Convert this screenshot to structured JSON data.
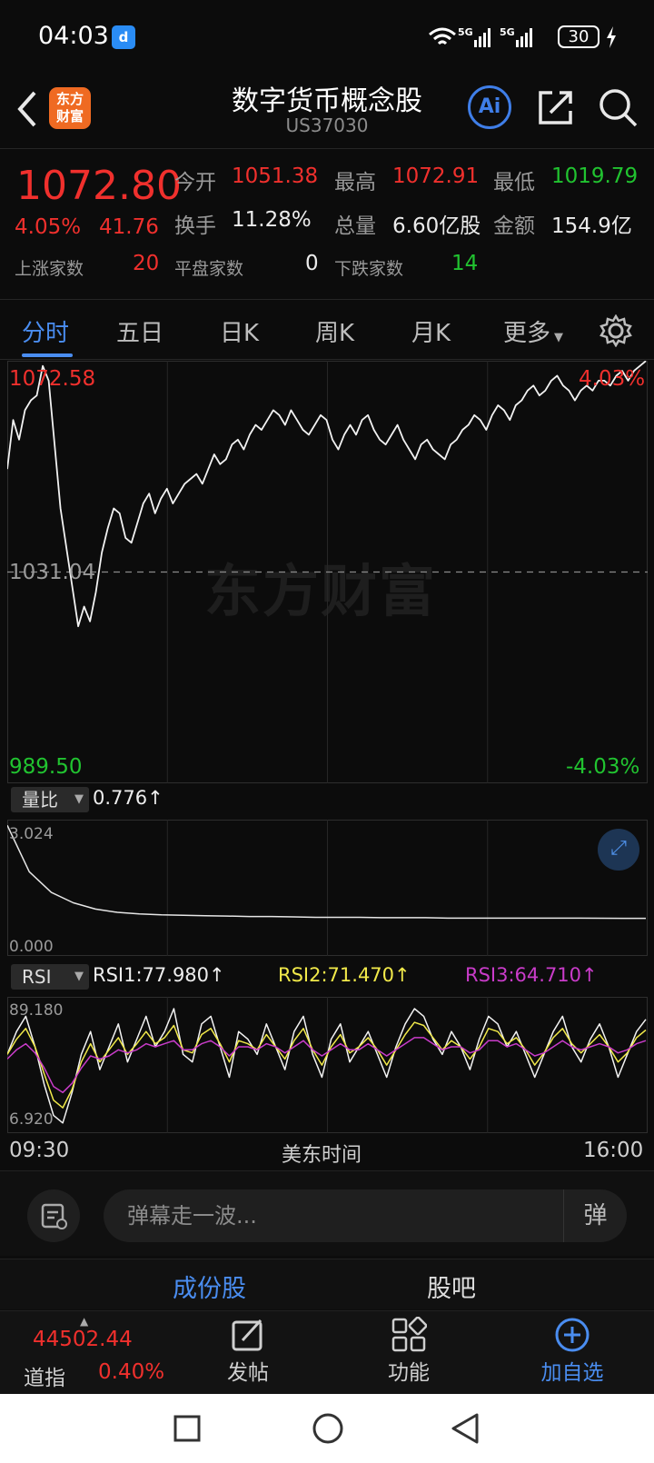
{
  "status_bar": {
    "time": "04:03",
    "app_badge": "d",
    "battery": "30",
    "net1": "5G",
    "net2": "5G"
  },
  "header": {
    "title": "数字货币概念股",
    "code": "US37030",
    "logo_text_1": "东方",
    "logo_text_2": "财富",
    "ai_label": "Ai"
  },
  "quote": {
    "price": "1072.80",
    "change_pct": "4.05%",
    "change_abs": "41.76",
    "open_label": "今开",
    "open": "1051.38",
    "high_label": "最高",
    "high": "1072.91",
    "low_label": "最低",
    "low": "1019.79",
    "turnover_label": "换手",
    "turnover": "11.28%",
    "volume_label": "总量",
    "volume": "6.60亿股",
    "amount_label": "金额",
    "amount": "154.9亿",
    "up_label": "上涨家数",
    "up_count": "20",
    "flat_label": "平盘家数",
    "flat_count": "0",
    "down_label": "下跌家数",
    "down_count": "14"
  },
  "tabs": [
    "分时",
    "五日",
    "日K",
    "周K",
    "月K",
    "更多"
  ],
  "main_chart": {
    "max_label": "1072.58",
    "max_pct": "4.03%",
    "mid_label": "1031.04",
    "min_label": "989.50",
    "min_pct": "-4.03%",
    "watermark": "东方财富",
    "colors": {
      "line": "#f2f2f2",
      "up": "#f0302d",
      "down": "#21c330"
    }
  },
  "volume_ratio": {
    "label": "量比",
    "value": "0.776",
    "arrow": "↑",
    "max_label": "3.024",
    "min_label": "0.000"
  },
  "rsi": {
    "label": "RSI",
    "rsi1": "RSI1:77.980",
    "rsi2": "RSI2:71.470",
    "rsi3": "RSI3:64.710",
    "arrow": "↑",
    "max_label": "89.180",
    "min_label": "6.920",
    "colors": {
      "rsi1": "#f2f2f2",
      "rsi2": "#f1e94a",
      "rsi3": "#c93cc9"
    }
  },
  "time_axis": {
    "start": "09:30",
    "middle": "美东时间",
    "end": "16:00"
  },
  "comment": {
    "placeholder": "弹幕走一波...",
    "danmaku_label": "弹"
  },
  "sub_tabs": {
    "components": "成份股",
    "forum": "股吧"
  },
  "bottom_bar": {
    "index_value": "44502.44",
    "index_name": "道指",
    "index_pct": "0.40%",
    "post_label": "发帖",
    "func_label": "功能",
    "watch_label": "加自选"
  },
  "chart_data": [
    {
      "type": "line",
      "title": "",
      "xlabel": "美东时间",
      "ylabel": "",
      "x_range": [
        "09:30",
        "16:00"
      ],
      "ylim": [
        989.5,
        1072.58
      ],
      "reference": 1031.04,
      "series": [
        {
          "values": [
            1052,
            1062,
            1058,
            1064,
            1066,
            1067,
            1073,
            1070,
            1057,
            1044,
            1036,
            1028,
            1020,
            1024,
            1021,
            1027,
            1035,
            1040,
            1044,
            1043,
            1038,
            1037,
            1041,
            1045,
            1047,
            1043,
            1046,
            1048,
            1045,
            1047,
            1049,
            1050,
            1051,
            1049,
            1052,
            1055,
            1053,
            1054,
            1057,
            1058,
            1056,
            1059,
            1061,
            1060,
            1062,
            1064,
            1063,
            1061,
            1064,
            1062,
            1060,
            1059,
            1061,
            1063,
            1062,
            1058,
            1056,
            1059,
            1061,
            1059,
            1062,
            1063,
            1060,
            1058,
            1057,
            1059,
            1061,
            1058,
            1056,
            1054,
            1057,
            1058,
            1056,
            1055,
            1054,
            1057,
            1058,
            1060,
            1061,
            1063,
            1062,
            1060,
            1063,
            1065,
            1064,
            1062,
            1065,
            1066,
            1068,
            1069,
            1067,
            1068,
            1070,
            1071,
            1069,
            1068,
            1066,
            1068,
            1069,
            1068,
            1070,
            1070,
            1069,
            1071,
            1072,
            1070,
            1072,
            1073,
            1074
          ]
        }
      ]
    },
    {
      "type": "line",
      "title": "",
      "ylim": [
        0,
        3.024
      ],
      "series": [
        {
          "name": "量比",
          "values": [
            3.02,
            1.9,
            1.4,
            1.15,
            1.0,
            0.92,
            0.88,
            0.86,
            0.85,
            0.84,
            0.83,
            0.82,
            0.82,
            0.81,
            0.8,
            0.8,
            0.8,
            0.79,
            0.79,
            0.79,
            0.78,
            0.78,
            0.78,
            0.78,
            0.78,
            0.78,
            0.78,
            0.778,
            0.776,
            0.776
          ]
        }
      ]
    },
    {
      "type": "line",
      "title": "",
      "ylim": [
        6.92,
        89.18
      ],
      "series": [
        {
          "name": "RSI1",
          "values": [
            55,
            70,
            80,
            60,
            35,
            15,
            10,
            30,
            55,
            70,
            45,
            60,
            75,
            50,
            65,
            80,
            60,
            70,
            85,
            55,
            50,
            75,
            80,
            60,
            40,
            70,
            65,
            55,
            75,
            60,
            45,
            70,
            80,
            55,
            40,
            65,
            75,
            50,
            60,
            70,
            55,
            40,
            60,
            75,
            85,
            80,
            65,
            55,
            70,
            60,
            45,
            65,
            80,
            75,
            60,
            70,
            55,
            40,
            55,
            70,
            80,
            60,
            50,
            65,
            75,
            60,
            40,
            55,
            70,
            78
          ]
        },
        {
          "name": "RSI2",
          "values": [
            55,
            65,
            72,
            60,
            42,
            25,
            20,
            32,
            50,
            62,
            50,
            58,
            66,
            55,
            62,
            70,
            62,
            66,
            74,
            58,
            56,
            68,
            72,
            62,
            50,
            64,
            62,
            58,
            68,
            60,
            52,
            64,
            72,
            58,
            48,
            60,
            68,
            56,
            60,
            66,
            58,
            48,
            58,
            68,
            76,
            74,
            66,
            58,
            64,
            60,
            52,
            60,
            72,
            70,
            62,
            66,
            58,
            48,
            56,
            66,
            72,
            62,
            56,
            62,
            68,
            60,
            50,
            56,
            66,
            71
          ]
        },
        {
          "name": "RSI3",
          "values": [
            52,
            58,
            62,
            56,
            46,
            34,
            30,
            36,
            46,
            54,
            52,
            54,
            58,
            56,
            58,
            62,
            60,
            62,
            64,
            58,
            58,
            62,
            64,
            60,
            54,
            60,
            60,
            58,
            62,
            60,
            56,
            60,
            64,
            58,
            54,
            58,
            62,
            58,
            58,
            62,
            58,
            54,
            58,
            62,
            66,
            66,
            62,
            58,
            60,
            60,
            56,
            58,
            64,
            64,
            60,
            62,
            58,
            54,
            56,
            60,
            64,
            60,
            58,
            60,
            62,
            60,
            56,
            58,
            62,
            64
          ]
        }
      ]
    }
  ]
}
